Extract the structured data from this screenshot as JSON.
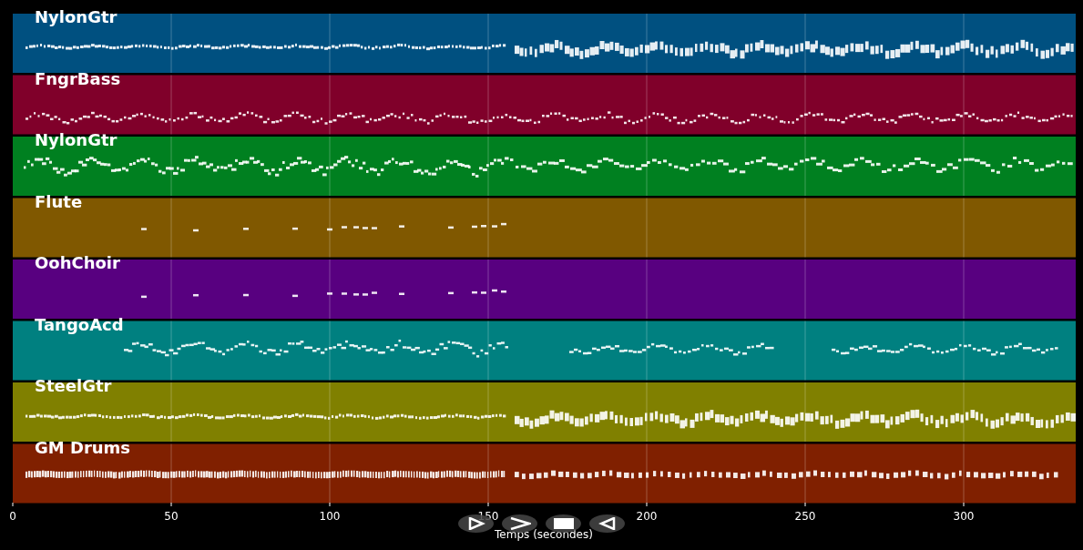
{
  "tracks": [
    {
      "name": "NylonGtr",
      "color": "#005080"
    },
    {
      "name": "FngrBass",
      "color": "#80002a"
    },
    {
      "name": "NylonGtr",
      "color": "#008020"
    },
    {
      "name": "Flute",
      "color": "#805800"
    },
    {
      "name": "OohChoir",
      "color": "#580080"
    },
    {
      "name": "TangoAcd",
      "color": "#008080"
    },
    {
      "name": "SteelGtr",
      "color": "#808000"
    },
    {
      "name": "GM Drums",
      "color": "#802000"
    }
  ],
  "x_axis": {
    "label": "Temps (secondes)",
    "ticks": [
      "0",
      "50",
      "100",
      "150",
      "200",
      "250",
      "300"
    ]
  },
  "controls": [
    {
      "kind": "play"
    },
    {
      "kind": "forward"
    },
    {
      "kind": "stop"
    },
    {
      "kind": "back"
    }
  ]
}
